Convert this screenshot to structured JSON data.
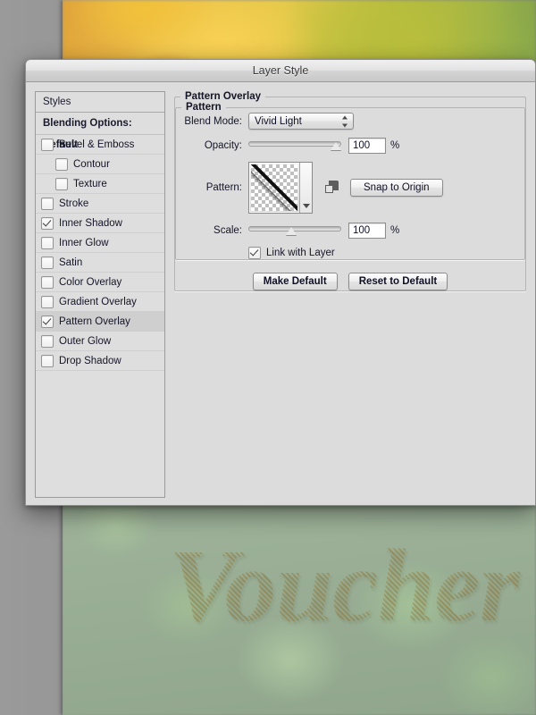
{
  "window": {
    "title": "Layer Style"
  },
  "sidebar": {
    "styles_header": "Styles",
    "blending_options": "Blending Options: Default",
    "items": [
      {
        "label": "Bevel & Emboss",
        "checked": false,
        "indent": false,
        "selected": false
      },
      {
        "label": "Contour",
        "checked": false,
        "indent": true,
        "selected": false
      },
      {
        "label": "Texture",
        "checked": false,
        "indent": true,
        "selected": false
      },
      {
        "label": "Stroke",
        "checked": false,
        "indent": false,
        "selected": false
      },
      {
        "label": "Inner Shadow",
        "checked": true,
        "indent": false,
        "selected": false
      },
      {
        "label": "Inner Glow",
        "checked": false,
        "indent": false,
        "selected": false
      },
      {
        "label": "Satin",
        "checked": false,
        "indent": false,
        "selected": false
      },
      {
        "label": "Color Overlay",
        "checked": false,
        "indent": false,
        "selected": false
      },
      {
        "label": "Gradient Overlay",
        "checked": false,
        "indent": false,
        "selected": false
      },
      {
        "label": "Pattern Overlay",
        "checked": true,
        "indent": false,
        "selected": true
      },
      {
        "label": "Outer Glow",
        "checked": false,
        "indent": false,
        "selected": false
      },
      {
        "label": "Drop Shadow",
        "checked": false,
        "indent": false,
        "selected": false
      }
    ]
  },
  "panel": {
    "outer_legend": "Pattern Overlay",
    "inner_legend": "Pattern",
    "blend_mode": {
      "label": "Blend Mode:",
      "value": "Vivid Light"
    },
    "opacity": {
      "label": "Opacity:",
      "value": "100",
      "unit": "%",
      "slider_percent": 100
    },
    "pattern": {
      "label": "Pattern:",
      "swatch_icon": "diagonal-line-pattern-swatch",
      "dropdown_icon": "chevron-down-icon",
      "new_pattern_icon": "new-pattern-icon",
      "snap_button": "Snap to Origin"
    },
    "scale": {
      "label": "Scale:",
      "value": "100",
      "unit": "%",
      "slider_percent": 46
    },
    "link_with_layer": {
      "label": "Link with Layer",
      "checked": true
    },
    "make_default_button": "Make Default",
    "reset_default_button": "Reset to Default"
  },
  "document": {
    "headline": "Voucher",
    "headline_color": "#eeb128"
  },
  "colors": {
    "dialog_background": "#dcdcdc",
    "titlebar": "#e3e3e3",
    "selected_row": "#cfcfcf",
    "workspace": "#8d8d8d"
  }
}
